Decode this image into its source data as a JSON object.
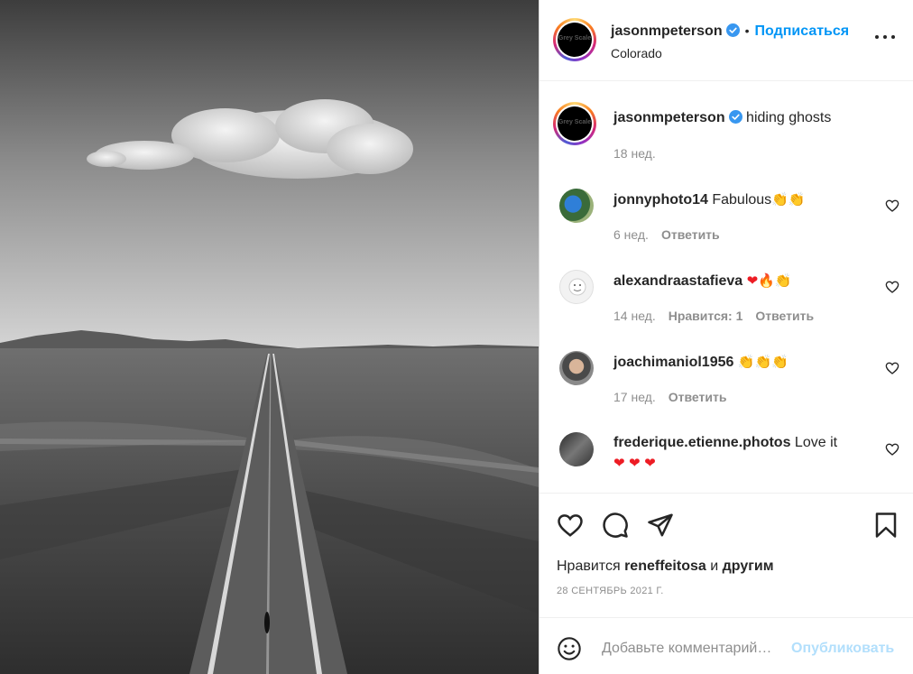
{
  "post": {
    "username": "jasonmpeterson",
    "follow_label": "Подписаться",
    "location": "Colorado",
    "avatar_text": "Grey Scale",
    "caption": {
      "username": "jasonmpeterson",
      "text": "hiding ghosts",
      "time": "18 нед."
    }
  },
  "comments": [
    {
      "username": "jonnyphoto14",
      "text": "Fabulous",
      "emoji": [
        "👏",
        "👏"
      ],
      "time": "6 нед.",
      "likes": "",
      "reply": "Ответить"
    },
    {
      "username": "alexandraastafieva",
      "text": "",
      "emoji": [
        "❤",
        "🔥",
        "👏"
      ],
      "time": "14 нед.",
      "likes": "Нравится: 1",
      "reply": "Ответить"
    },
    {
      "username": "joachimaniol1956",
      "text": "",
      "emoji": [
        "👏",
        "👏",
        "👏"
      ],
      "time": "17 нед.",
      "likes": "",
      "reply": "Ответить"
    },
    {
      "username": "frederique.etienne.photos",
      "text": "Love it",
      "emoji": [
        "❤",
        "❤",
        "❤"
      ],
      "time": "",
      "likes": "",
      "reply": ""
    }
  ],
  "likes_line": {
    "prefix": "Нравится",
    "user": "reneffeitosa",
    "middle": "и",
    "others": "другим"
  },
  "date": "28 СЕНТЯБРЬ 2021 Г.",
  "add_comment": {
    "placeholder": "Добавьте комментарий…",
    "publish_label": "Опубликовать"
  },
  "icons": {
    "verified": "verified-badge-icon",
    "more": "more-options-icon",
    "like": "heart-icon",
    "comment": "comment-bubble-icon",
    "share": "paper-plane-icon",
    "save": "bookmark-icon",
    "emoji": "smiley-icon"
  },
  "colors": {
    "accent": "#0095f6",
    "publish_disabled": "#b2dffc",
    "verified": "#3897f0",
    "secondary_text": "#8e8e8e"
  }
}
